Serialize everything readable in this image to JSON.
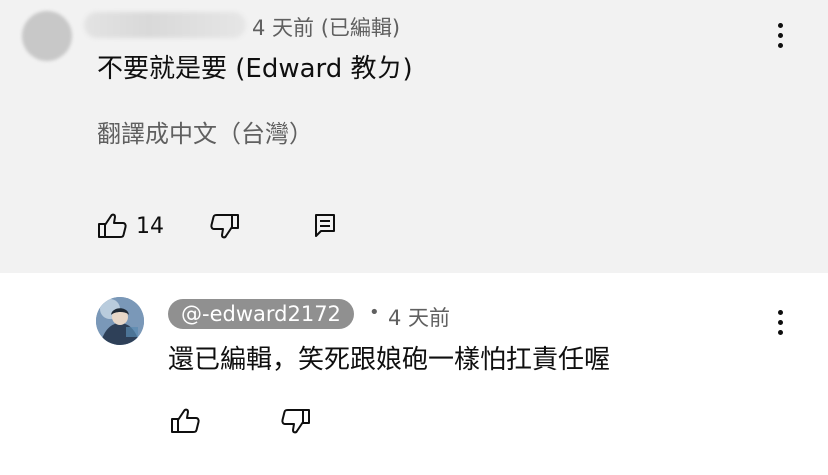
{
  "comments": [
    {
      "time": "4 天前 (已編輯)",
      "text": "不要就是要 (Edward 教ㄉ)",
      "translate_label": "翻譯成中文（台灣）",
      "likes": "14"
    },
    {
      "handle": "@-edward2172",
      "dot": "•",
      "time": "4 天前",
      "text": "還已編輯，笑死跟娘砲一樣怕扛責任喔"
    }
  ]
}
